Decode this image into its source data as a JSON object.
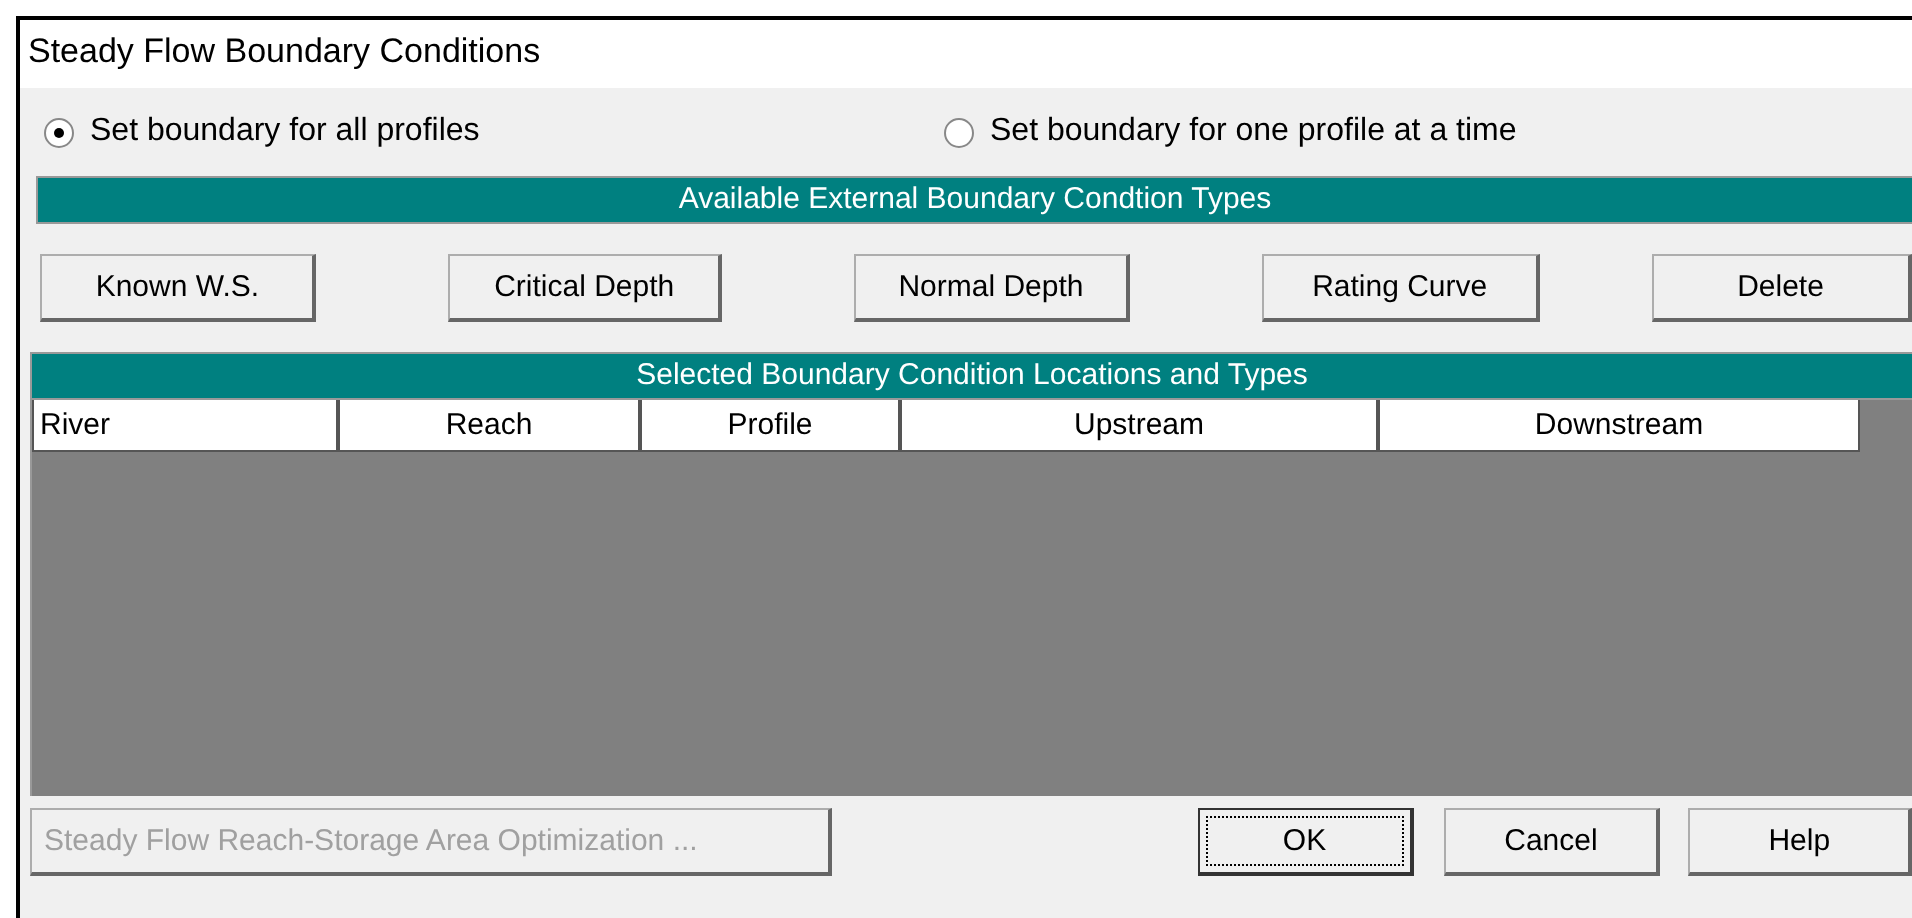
{
  "window": {
    "title": "Steady Flow Boundary Conditions"
  },
  "mode_options": [
    {
      "label": "Set boundary for all profiles",
      "selected": true
    },
    {
      "label": "Set boundary for one profile at a time",
      "selected": false
    }
  ],
  "types_header": "Available External Boundary Condtion Types",
  "type_buttons": [
    "Known W.S.",
    "Critical Depth",
    "Normal Depth",
    "Rating Curve",
    "Delete"
  ],
  "locations_header": "Selected Boundary Condition Locations and Types",
  "table": {
    "columns": [
      "River",
      "Reach",
      "Profile",
      "Upstream",
      "Downstream"
    ]
  },
  "footer_buttons": [
    {
      "label": "Steady Flow Reach-Storage Area Optimization ...",
      "disabled": true,
      "focused": false
    },
    {
      "label": "OK",
      "disabled": false,
      "focused": true
    },
    {
      "label": "Cancel",
      "disabled": false,
      "focused": false
    },
    {
      "label": "Help",
      "disabled": false,
      "focused": false
    }
  ]
}
